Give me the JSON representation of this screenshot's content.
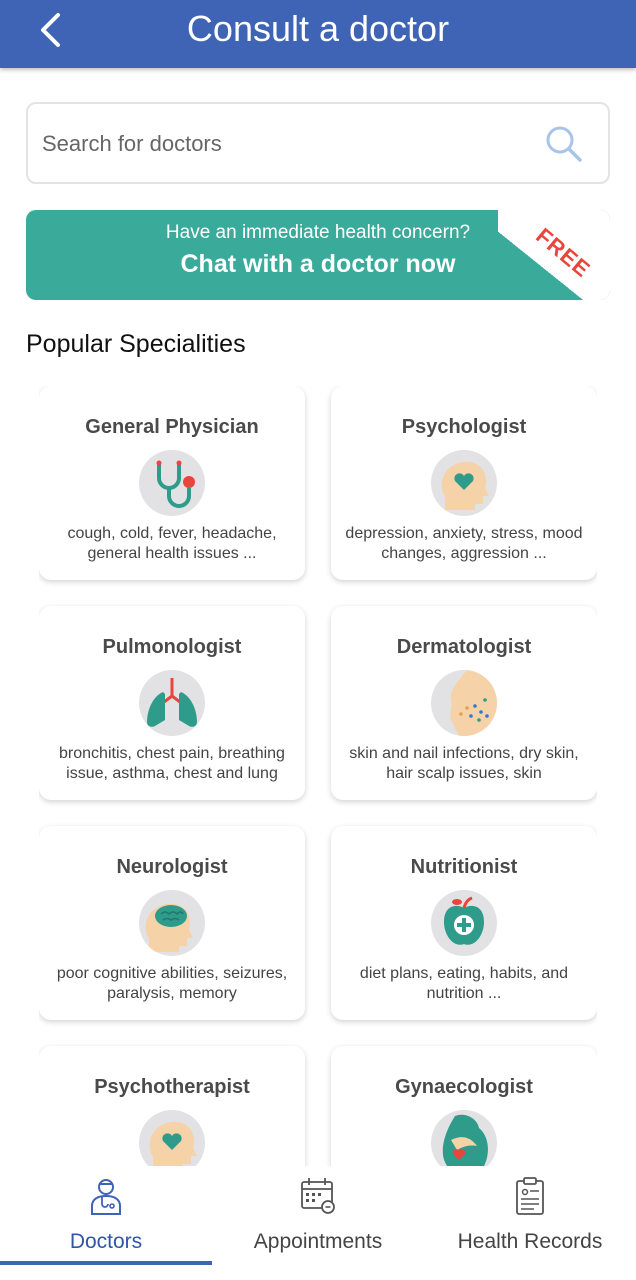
{
  "header": {
    "title": "Consult a doctor",
    "back_icon": "chevron-left-icon"
  },
  "search": {
    "placeholder": "Search for doctors",
    "value": "",
    "icon": "search-icon"
  },
  "banner": {
    "subtitle": "Have an immediate health concern?",
    "cta": "Chat with a doctor now",
    "badge": "FREE"
  },
  "section_title": "Popular Specialities",
  "specialities": [
    {
      "title": "General Physician",
      "icon": "stethoscope-icon",
      "desc": "cough, cold, fever, headache, general health issues ..."
    },
    {
      "title": "Psychologist",
      "icon": "head-heart-icon",
      "desc": "depression, anxiety, stress, mood changes, aggression ..."
    },
    {
      "title": "Pulmonologist",
      "icon": "lungs-icon",
      "desc": "bronchitis, chest pain, breathing issue, asthma, chest and lung"
    },
    {
      "title": "Dermatologist",
      "icon": "skin-icon",
      "desc": "skin and nail infections, dry skin, hair scalp issues, skin"
    },
    {
      "title": "Neurologist",
      "icon": "brain-icon",
      "desc": "poor cognitive abilities, seizures, paralysis, memory"
    },
    {
      "title": "Nutritionist",
      "icon": "apple-icon",
      "desc": "diet plans, eating, habits,  and nutrition ..."
    },
    {
      "title": "Psychotherapist",
      "icon": "head-heart-icon",
      "desc": ""
    },
    {
      "title": "Gynaecologist",
      "icon": "pregnancy-icon",
      "desc": ""
    }
  ],
  "nav": [
    {
      "label": "Doctors",
      "icon": "doctor-icon",
      "active": true
    },
    {
      "label": "Appointments",
      "icon": "calendar-icon",
      "active": false
    },
    {
      "label": "Health Records",
      "icon": "clipboard-icon",
      "active": false
    }
  ],
  "colors": {
    "primary": "#3f63b5",
    "banner": "#3aab9b",
    "accent_teal": "#2e9b8b",
    "accent_red": "#e8463c"
  }
}
